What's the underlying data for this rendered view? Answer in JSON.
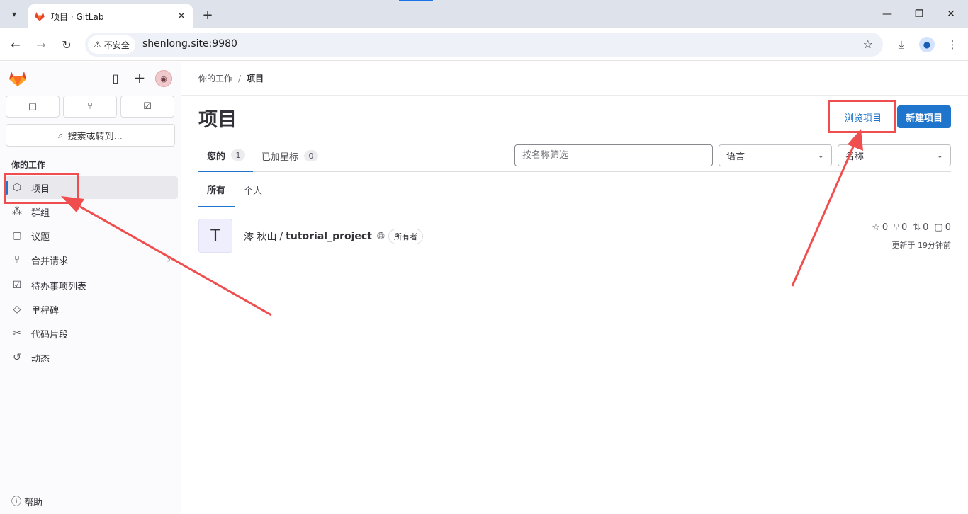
{
  "browser": {
    "tab_title": "项目 · GitLab",
    "security_label": "不安全",
    "url": "shenlong.site:9980"
  },
  "sidebar": {
    "search_label": "搜索或转到...",
    "section_title": "你的工作",
    "items": [
      {
        "label": "项目",
        "icon": "project-icon"
      },
      {
        "label": "群组",
        "icon": "group-icon"
      },
      {
        "label": "议题",
        "icon": "issues-icon"
      },
      {
        "label": "合并请求",
        "icon": "merge-request-icon"
      },
      {
        "label": "待办事项列表",
        "icon": "todo-icon"
      },
      {
        "label": "里程碑",
        "icon": "milestone-icon"
      },
      {
        "label": "代码片段",
        "icon": "snippet-icon"
      },
      {
        "label": "动态",
        "icon": "activity-icon"
      }
    ],
    "help_label": "帮助"
  },
  "breadcrumb": {
    "parent": "你的工作",
    "current": "项目"
  },
  "page": {
    "title": "项目",
    "browse_label": "浏览项目",
    "new_label": "新建项目"
  },
  "tabs": [
    {
      "label": "您的",
      "count": "1"
    },
    {
      "label": "已加星标",
      "count": "0"
    }
  ],
  "filter": {
    "placeholder": "按名称筛选",
    "language_label": "语言",
    "sort_label": "名称"
  },
  "subtabs": {
    "all": "所有",
    "personal": "个人"
  },
  "project": {
    "avatar_letter": "T",
    "namespace": "澪 秋山",
    "separator": "/",
    "name": "tutorial_project",
    "role": "所有者",
    "stars": "0",
    "forks": "0",
    "merge_requests": "0",
    "issues": "0",
    "updated": "更新于 19分钟前"
  },
  "annotation_color": "#f04e4e",
  "accent_color": "#1f75cb"
}
